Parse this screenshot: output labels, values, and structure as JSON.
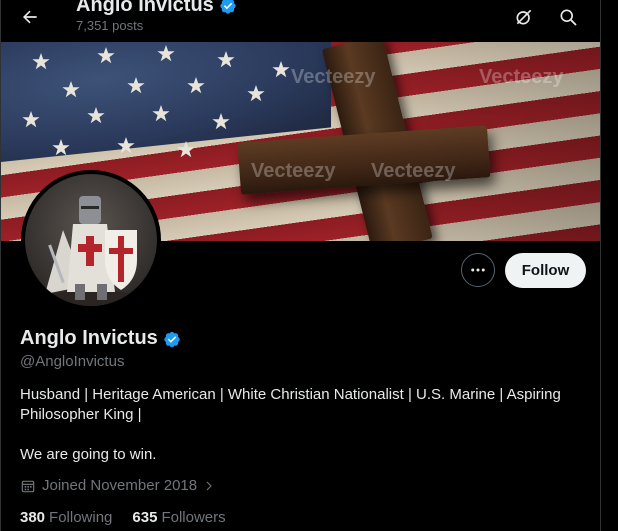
{
  "header": {
    "title": "Anglo Invictus",
    "posts_count": "7,351 posts",
    "back_icon": "arrow-left-icon",
    "grok_icon": "grok-icon",
    "search_icon": "search-icon"
  },
  "banner": {
    "watermark": "Vecteezy"
  },
  "actions": {
    "more_icon": "more-horizontal-icon",
    "follow_label": "Follow"
  },
  "profile": {
    "display_name": "Anglo Invictus",
    "handle": "@AngloInvictus",
    "bio_line1": "Husband | Heritage American | White Christian Nationalist | U.S. Marine | Aspiring Philosopher King  |",
    "bio_line2": "We are going to win.",
    "joined": "Joined November 2018",
    "following_count": "380",
    "following_label": "Following",
    "followers_count": "635",
    "followers_label": "Followers"
  },
  "colors": {
    "background": "#000000",
    "verified_blue": "#1d9bf0",
    "secondary_text": "#71767b",
    "follow_button": "#eff3f4"
  }
}
